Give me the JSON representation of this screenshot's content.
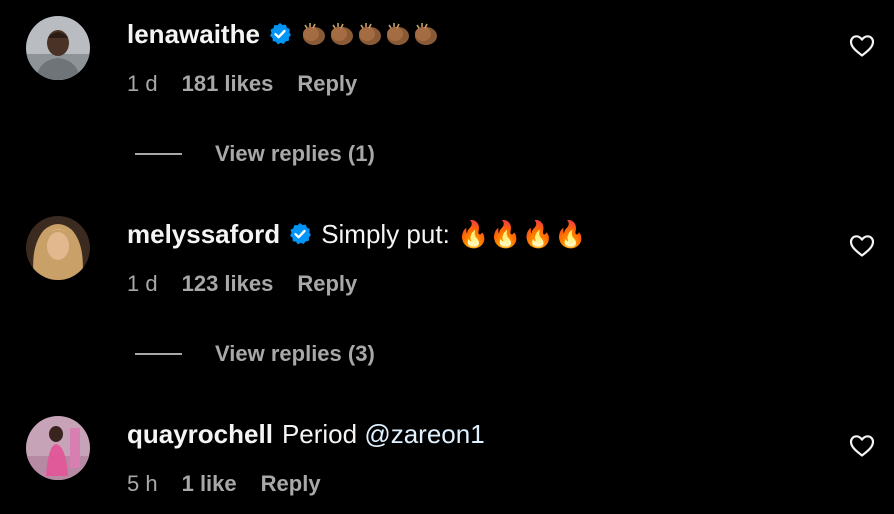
{
  "comments": [
    {
      "username": "lenawaithe",
      "verified": true,
      "text": "👏🏾👏🏾👏🏾👏🏾👏🏾",
      "time": "1 d",
      "likes": "181 likes",
      "reply": "Reply",
      "view_replies": "View replies (1)",
      "avatar_icon": "avatar-person-grey",
      "like_icon": "heart-outline-icon"
    },
    {
      "username": "melyssaford",
      "verified": true,
      "text": "Simply put: 🔥🔥🔥🔥",
      "time": "1 d",
      "likes": "123 likes",
      "reply": "Reply",
      "view_replies": "View replies (3)",
      "avatar_icon": "avatar-person-blonde",
      "like_icon": "heart-outline-icon"
    },
    {
      "username": "quayrochell",
      "verified": false,
      "text_prefix": "Period ",
      "mention": "@zareon1",
      "time": "5 h",
      "likes": "1 like",
      "reply": "Reply",
      "avatar_icon": "avatar-person-pink",
      "like_icon": "heart-outline-icon"
    }
  ],
  "colors": {
    "background": "#000000",
    "primary_text": "#f5f5f5",
    "secondary_text": "#a8a8a8",
    "verified_blue": "#0095f6",
    "mention": "#e0f1ff"
  }
}
